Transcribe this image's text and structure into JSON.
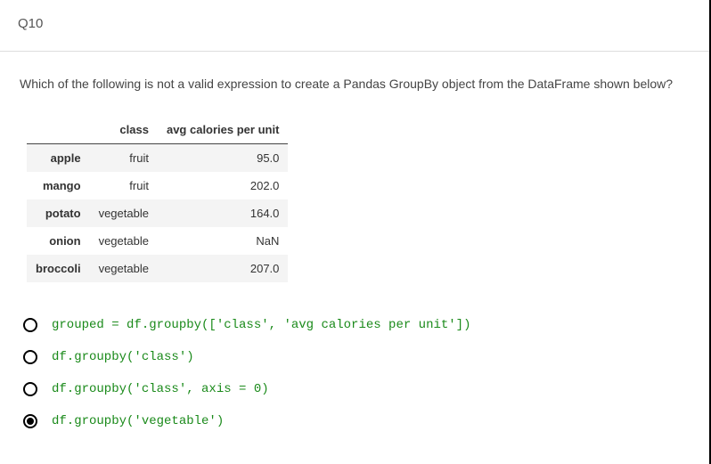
{
  "header": {
    "qnum": "Q10"
  },
  "question": "Which of the following is not a valid expression to create a Pandas GroupBy object from the DataFrame shown below?",
  "table": {
    "columns": [
      "class",
      "avg calories per unit"
    ],
    "rows": [
      {
        "label": "apple",
        "class": "fruit",
        "value": "95.0"
      },
      {
        "label": "mango",
        "class": "fruit",
        "value": "202.0"
      },
      {
        "label": "potato",
        "class": "vegetable",
        "value": "164.0"
      },
      {
        "label": "onion",
        "class": "vegetable",
        "value": "NaN"
      },
      {
        "label": "broccoli",
        "class": "vegetable",
        "value": "207.0"
      }
    ]
  },
  "options": [
    {
      "selected": false,
      "code": "grouped = df.groupby(['class', 'avg calories per unit'])"
    },
    {
      "selected": false,
      "code": "df.groupby('class')"
    },
    {
      "selected": false,
      "code": "df.groupby('class', axis = 0)"
    },
    {
      "selected": true,
      "code": "df.groupby('vegetable')"
    }
  ]
}
